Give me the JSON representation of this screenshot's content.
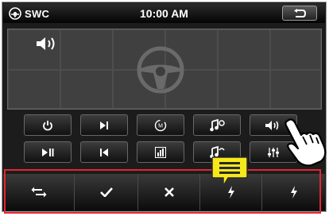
{
  "header": {
    "brand": "SWC",
    "time": "10:00 AM",
    "brand_icon": "steering-circle-icon",
    "back_icon": "return-arrow-icon"
  },
  "panel": {
    "icons": [
      "volume-icon",
      "steering-wheel-icon"
    ]
  },
  "controls": {
    "row1": [
      "power-icon",
      "next-track-icon",
      "mode-icon",
      "music-phone-icon",
      "volume-up-icon"
    ],
    "row2": [
      "play-pause-icon",
      "previous-track-icon",
      "equalizer-icon",
      "music-hangup-icon",
      "sliders-icon"
    ]
  },
  "bottom_bar": {
    "items": [
      "swap-arrows-icon",
      "checkmark-icon",
      "cross-icon",
      "lightning-icon",
      "lightning-icon"
    ]
  },
  "colors": {
    "highlight": "#e3262f",
    "callout": "#f7e81b",
    "background": "#1c1c1c"
  }
}
